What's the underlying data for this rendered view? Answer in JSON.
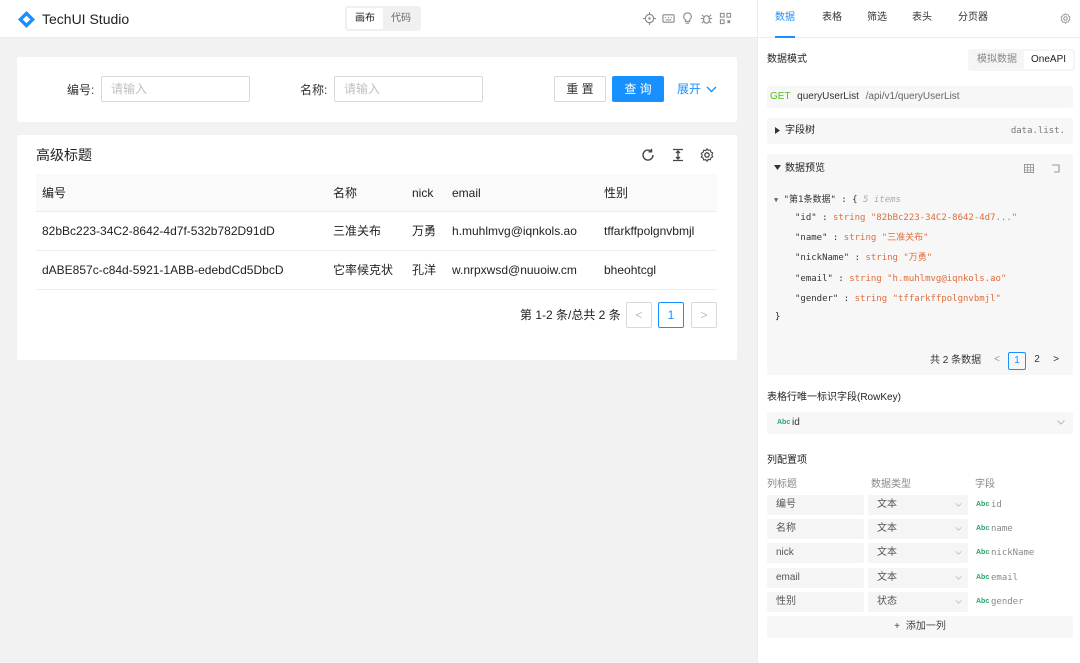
{
  "app": {
    "title": "TechUI Studio"
  },
  "mode_tabs": [
    {
      "label": "画布",
      "active": true
    },
    {
      "label": "代码",
      "active": false
    }
  ],
  "toolbar_icons": [
    "target-icon",
    "keyboard-icon",
    "bulb-icon",
    "bug-icon",
    "qrcode-icon"
  ],
  "filter": {
    "fields": [
      {
        "label": "编号",
        "placeholder": "请输入"
      },
      {
        "label": "名称",
        "placeholder": "请输入"
      }
    ],
    "reset_label": "重 置",
    "query_label": "查 询",
    "expand_label": "展开"
  },
  "table": {
    "title": "高级标题",
    "columns": [
      "编号",
      "名称",
      "nick",
      "email",
      "性别"
    ],
    "rows": [
      [
        "82bBc223-34C2-8642-4d7f-532b782D91dD",
        "三准关布",
        "万勇",
        "h.muhlmvg@iqnkols.ao",
        "tffarkffpolgnvbmjl"
      ],
      [
        "dABE857c-c84d-5921-1ABB-edebdCd5DbcD",
        "它率候克状",
        "孔洋",
        "w.nrpxwsd@nuuoiw.cm",
        "bheohtcgl"
      ]
    ],
    "pagination": {
      "summary": "第 1-2 条/总共 2 条",
      "prev": "<",
      "current": "1",
      "next": ">"
    }
  },
  "panel": {
    "tabs": [
      {
        "label": "数据",
        "active": true
      },
      {
        "label": "表格",
        "active": false
      },
      {
        "label": "筛选",
        "active": false
      },
      {
        "label": "表头",
        "active": false
      },
      {
        "label": "分页器",
        "active": false
      }
    ],
    "data_mode_label": "数据模式",
    "data_mode_options": [
      {
        "label": "模拟数据",
        "active": false
      },
      {
        "label": "OneAPI",
        "active": true
      }
    ],
    "api": {
      "method": "GET",
      "name": "queryUserList",
      "path": "/api/v1/queryUserList"
    },
    "field_tree": {
      "label": "字段树",
      "path": "data.list."
    },
    "preview": {
      "label": "数据预览",
      "root_key": "\"第1条数据\"",
      "root_comment": "5 items",
      "entries": [
        {
          "key": "\"id\"",
          "type": "string",
          "value": "\"82bBc223-34C2-8642-4d7...\""
        },
        {
          "key": "\"name\"",
          "type": "string",
          "value": "\"三准关布\""
        },
        {
          "key": "\"nickName\"",
          "type": "string",
          "value": "\"万勇\""
        },
        {
          "key": "\"email\"",
          "type": "string",
          "value": "\"h.muhlmvg@iqnkols.ao\""
        },
        {
          "key": "\"gender\"",
          "type": "string",
          "value": "\"tffarkffpolgnvbmjl\""
        }
      ],
      "total": "共 2 条数据",
      "pages": [
        "1",
        "2"
      ]
    },
    "rowkey": {
      "label": "表格行唯一标识字段(RowKey)",
      "value": "id"
    },
    "column_config": {
      "label": "列配置项",
      "headers": [
        "列标题",
        "数据类型",
        "字段"
      ],
      "rows": [
        {
          "title": "编号",
          "type": "文本",
          "field": "id"
        },
        {
          "title": "名称",
          "type": "文本",
          "field": "name"
        },
        {
          "title": "nick",
          "type": "文本",
          "field": "nickName"
        },
        {
          "title": "email",
          "type": "文本",
          "field": "email"
        },
        {
          "title": "性别",
          "type": "状态",
          "field": "gender"
        }
      ],
      "add_label": "添加一列"
    }
  },
  "colors": {
    "primary": "#1890ff",
    "panel_bg": "#f7f7f7",
    "page_bg": "#f2f2f2",
    "json_value": "#e06c3b",
    "abc_green": "#2aa36b",
    "get_green": "#52c41a"
  }
}
